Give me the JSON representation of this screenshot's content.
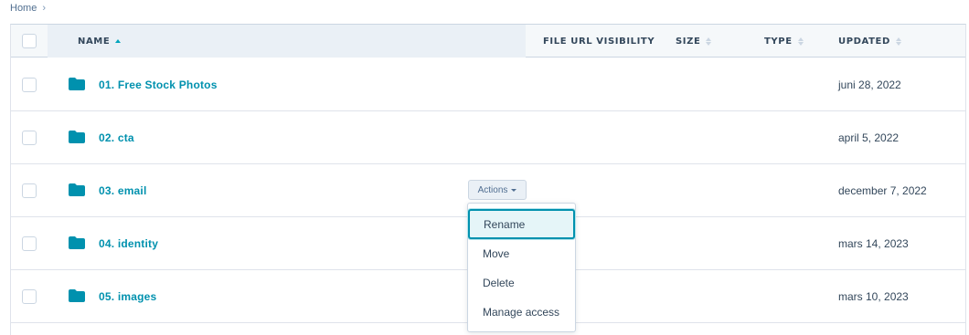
{
  "breadcrumb": {
    "home": "Home",
    "separator": "›"
  },
  "table": {
    "headers": {
      "name": "NAME",
      "file_url_visibility": "FILE URL VISIBILITY",
      "size": "SIZE",
      "type": "TYPE",
      "updated": "UPDATED"
    },
    "sorted_column": "name",
    "rows": [
      {
        "name": "01. Free Stock Photos",
        "updated": "juni 28, 2022"
      },
      {
        "name": "02. cta",
        "updated": "april 5, 2022"
      },
      {
        "name": "03. email",
        "updated": "december 7, 2022"
      },
      {
        "name": "04. identity",
        "updated": "mars 14, 2023"
      },
      {
        "name": "05. images",
        "updated": "mars 10, 2023"
      }
    ]
  },
  "actions": {
    "button_label": "Actions",
    "menu": [
      "Rename",
      "Move",
      "Delete",
      "Manage access"
    ],
    "focused_item": "Rename"
  },
  "colors": {
    "accent": "#0091ae",
    "folder": "#0091ae",
    "header_bg": "#f5f8fa",
    "text": "#33475b"
  },
  "icons": {
    "folder": "folder-icon",
    "sort": "sort-icon",
    "caret": "caret-down-icon"
  }
}
